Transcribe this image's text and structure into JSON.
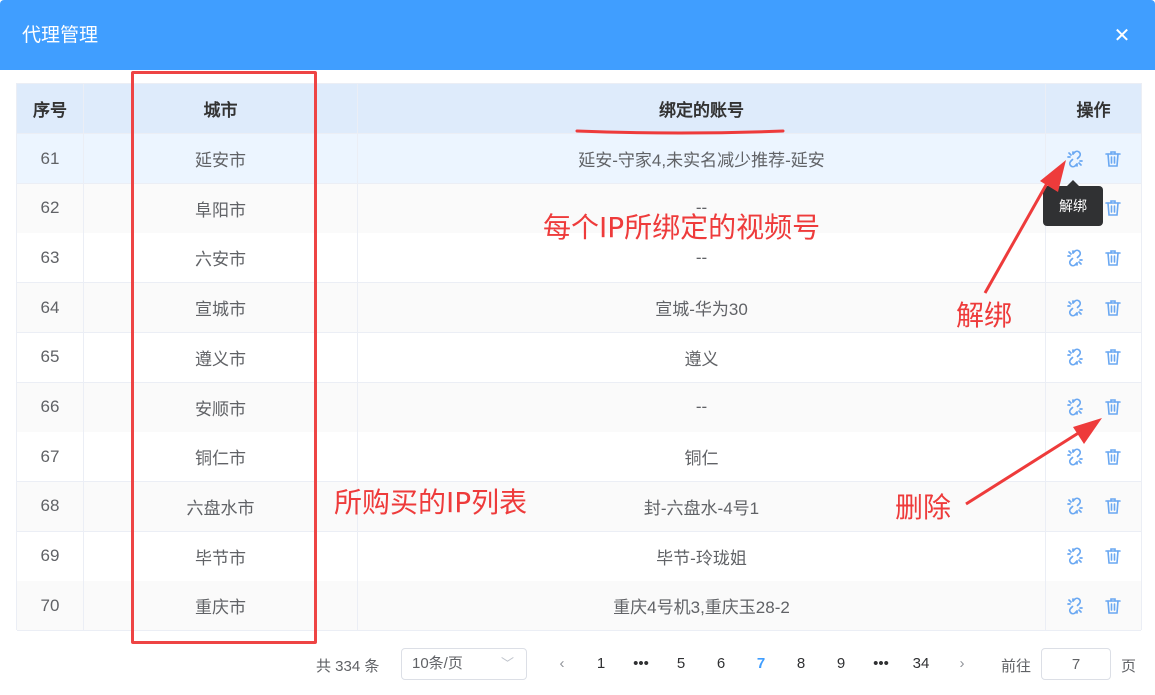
{
  "dialog": {
    "title": "代理管理",
    "close_symbol": "✕"
  },
  "table": {
    "headers": [
      "序号",
      "城市",
      "绑定的账号",
      "操作"
    ],
    "rows": [
      {
        "index": "61",
        "city": "延安市",
        "account": "延安-守家4,未实名减少推荐-延安"
      },
      {
        "index": "62",
        "city": "阜阳市",
        "account": "--"
      },
      {
        "index": "63",
        "city": "六安市",
        "account": "--"
      },
      {
        "index": "64",
        "city": "宣城市",
        "account": "宣城-华为30"
      },
      {
        "index": "65",
        "city": "遵义市",
        "account": "遵义"
      },
      {
        "index": "66",
        "city": "安顺市",
        "account": "--"
      },
      {
        "index": "67",
        "city": "铜仁市",
        "account": "铜仁"
      },
      {
        "index": "68",
        "city": "六盘水市",
        "account": "封-六盘水-4号1"
      },
      {
        "index": "69",
        "city": "毕节市",
        "account": "毕节-玲珑姐"
      },
      {
        "index": "70",
        "city": "重庆市",
        "account": "重庆4号机3,重庆玉28-2"
      }
    ],
    "row_action_icons": [
      "unlink-icon",
      "trash-icon"
    ],
    "tooltip": "解绑"
  },
  "pagination": {
    "total": "共 334 条",
    "page_size": "10条/页",
    "prev_symbol": "‹",
    "next_symbol": "›",
    "pages": [
      "1",
      "•••",
      "5",
      "6",
      "7",
      "8",
      "9",
      "•••",
      "34"
    ],
    "current_page": "7",
    "goto_label": "前往",
    "goto_value": "7",
    "page_unit": "页"
  },
  "annotations": {
    "ip_list": "所购买的IP列表",
    "bound_account": "每个IP所绑定的视频号",
    "unbind": "解绑",
    "delete": "删除"
  },
  "colors": {
    "header_bg": "#409eff",
    "accent": "#409eff",
    "annotation": "#ee3b3b",
    "table_header_bg": "#deebfb"
  }
}
